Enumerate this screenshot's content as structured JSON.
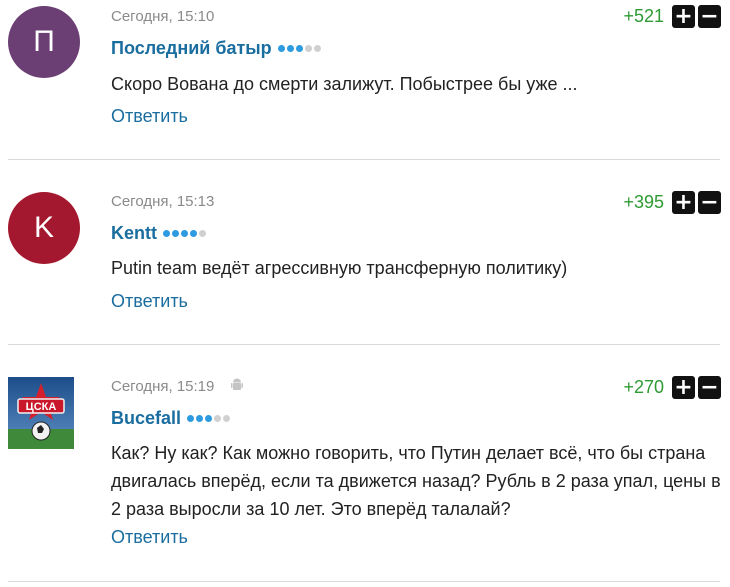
{
  "comments": [
    {
      "avatar_letter": "П",
      "avatar_color": "#6b3f73",
      "timestamp": "Сегодня, 15:10",
      "author": "Последний батыр",
      "rank_level": 3,
      "rank_max": 5,
      "score": "+521",
      "text": "Скоро Вована до смерти залижут. Побыстрее бы уже ...",
      "reply_label": "Ответить"
    },
    {
      "avatar_letter": "K",
      "avatar_color": "#a3182f",
      "timestamp": "Сегодня, 15:13",
      "author": "Kentt",
      "rank_level": 4,
      "rank_max": 5,
      "score": "+395",
      "text": "Putin team ведёт агрессивную трансферную политику)",
      "reply_label": "Ответить"
    },
    {
      "avatar_logo_text": "ЦСКА",
      "avatar_icon": "cska-logo",
      "device_icon": "android-icon",
      "timestamp": "Сегодня, 15:19",
      "author": "Bucefall",
      "rank_level": 3,
      "rank_max": 5,
      "score": "+270",
      "text": "Как? Ну как? Как можно говорить, что Путин делает всё, что бы страна двигалась вперёд, если та движется назад? Рубль в 2 раза упал, цены в 2 раза выросли за 10 лет. Это вперёд талалай?",
      "reply_label": "Ответить"
    }
  ],
  "vote": {
    "plus": "+",
    "minus": "−"
  },
  "colors": {
    "link": "#1a6d9f",
    "score": "#2e9b33",
    "rank_on": "#2d9be0",
    "rank_off": "#d0d0d0"
  }
}
